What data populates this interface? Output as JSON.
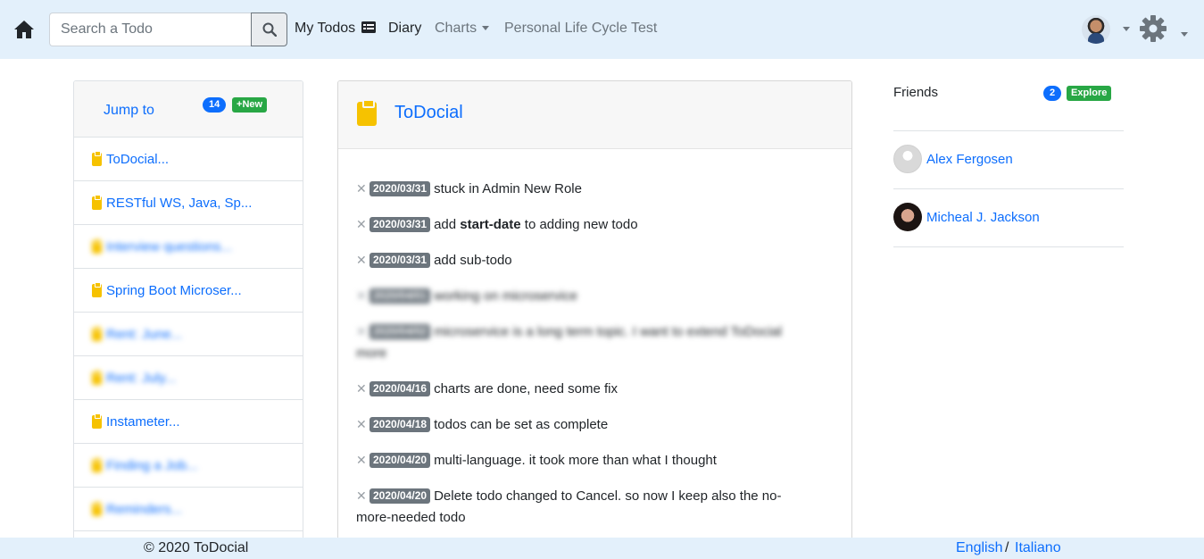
{
  "navbar": {
    "search_placeholder": "Search a Todo",
    "my_todos": "My Todos",
    "diary": "Diary",
    "charts": "Charts",
    "personal_life_cycle": "Personal Life Cycle Test"
  },
  "jump": {
    "title": "Jump to",
    "count": "14",
    "new_label": "New",
    "items": [
      {
        "label": "ToDocial...",
        "blurred": false
      },
      {
        "label": "RESTful WS, Java, Sp...",
        "blurred": false
      },
      {
        "label": "Interview questions...",
        "blurred": true
      },
      {
        "label": "Spring Boot Microser...",
        "blurred": false
      },
      {
        "label": "Rent: June...",
        "blurred": true
      },
      {
        "label": "Rent: July...",
        "blurred": true
      },
      {
        "label": "Instameter...",
        "blurred": false
      },
      {
        "label": "Finding a Job...",
        "blurred": true
      },
      {
        "label": "Reminders...",
        "blurred": true
      }
    ]
  },
  "main": {
    "title": "ToDocial",
    "todos": [
      {
        "date": "2020/03/31",
        "pre": "stuck in Admin New Role",
        "bold": "",
        "post": "",
        "line2": "",
        "blurred": false
      },
      {
        "date": "2020/03/31",
        "pre": "add ",
        "bold": "start-date",
        "post": " to adding new todo",
        "line2": "",
        "blurred": false
      },
      {
        "date": "2020/03/31",
        "pre": "add sub-todo",
        "bold": "",
        "post": "",
        "line2": "",
        "blurred": false
      },
      {
        "date": "2020/04/01",
        "pre": "working on microservice",
        "bold": "",
        "post": "",
        "line2": "",
        "blurred": true
      },
      {
        "date": "2020/04/02",
        "pre": "microservice is a long term topic. I want to extend ToDocial",
        "bold": "",
        "post": "",
        "line2": "more",
        "blurred": true
      },
      {
        "date": "2020/04/16",
        "pre": "charts are done, need some fix",
        "bold": "",
        "post": "",
        "line2": "",
        "blurred": false
      },
      {
        "date": "2020/04/18",
        "pre": "todos can be set as complete",
        "bold": "",
        "post": "",
        "line2": "",
        "blurred": false
      },
      {
        "date": "2020/04/20",
        "pre": "multi-language. it took more than what I thought",
        "bold": "",
        "post": "",
        "line2": "",
        "blurred": false
      },
      {
        "date": "2020/04/20",
        "pre": "Delete todo changed to Cancel. so now I keep also the no-",
        "bold": "",
        "post": "",
        "line2": "more-needed todo",
        "blurred": false
      }
    ]
  },
  "friends": {
    "title": "Friends",
    "count": "2",
    "explore_label": "Explore",
    "list": [
      {
        "name": "Alex Fergosen"
      },
      {
        "name": "Micheal J. Jackson"
      }
    ]
  },
  "footer": {
    "copyright": "© 2020 ToDocial",
    "lang_en": "English",
    "lang_sep": "/",
    "lang_it": "Italiano"
  },
  "colors": {
    "navbar_bg": "#e3f0fb",
    "link": "#0d6efd",
    "badge_green": "#28a745",
    "date_badge": "#6c757d",
    "clipboard": "#f6c200"
  }
}
